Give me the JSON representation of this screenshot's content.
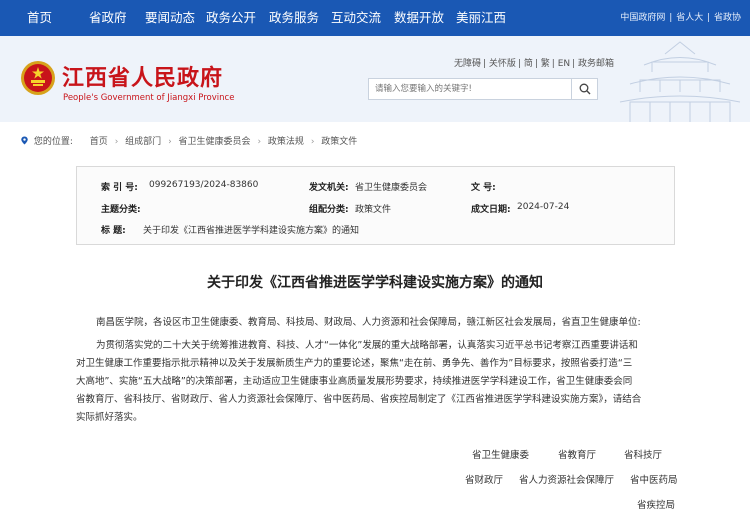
{
  "nav": {
    "items": [
      "首页",
      "省政府",
      "要闻动态",
      "政务公开",
      "政务服务",
      "互动交流",
      "数据开放",
      "美丽江西"
    ],
    "right": [
      "中国政府网",
      "省人大",
      "省政协"
    ]
  },
  "header": {
    "title": "江西省人民政府",
    "subtitle": "People's Government of Jiangxi Province",
    "util": [
      "无障碍",
      "关怀版",
      "简",
      "繁",
      "EN",
      "政务邮箱"
    ],
    "search_placeholder": "请输入您要输入的关键字!"
  },
  "breadcrumb": {
    "label": "您的位置:",
    "items": [
      "首页",
      "组成部门",
      "省卫生健康委员会",
      "政策法规",
      "政策文件"
    ]
  },
  "meta": {
    "index_label": "索  引 号:",
    "index_value": "099267193/2024-83860",
    "issuer_label": "发文机关:",
    "issuer_value": "省卫生健康委员会",
    "docno_label": "文    号:",
    "docno_value": "",
    "subject_label": "主题分类:",
    "subject_value": "",
    "org_label": "组配分类:",
    "org_value": "政策文件",
    "date_label": "成文日期:",
    "date_value": "2024-07-24",
    "heading_label": "标    题:",
    "heading_value": "关于印发《江西省推进医学学科建设实施方案》的通知"
  },
  "article": {
    "title": "关于印发《江西省推进医学学科建设实施方案》的通知",
    "addressee": "南昌医学院，各设区市卫生健康委、教育局、科技局、财政局、人力资源和社会保障局，赣江新区社会发展局，省直卫生健康单位:",
    "body_lines": [
      "为贯彻落实党的二十大关于统筹推进教育、科技、人才“一体化”发展的重大战略部署，认真落实习近平总书记考察江西重要讲话和",
      "对卫生健康工作重要指示批示精神以及关于发展新质生产力的重要论述，聚焦“走在前、勇争先、善作为”目标要求，按照省委打造“三",
      "大高地”、实施“五大战略”的决策部署，主动适应卫生健康事业高质量发展形势要求，持续推进医学学科建设工作，省卫生健康委会同",
      "省教育厅、省科技厅、省财政厅、省人力资源社会保障厅、省中医药局、省疾控局制定了《江西省推进医学学科建设实施方案》，请结合",
      "实际抓好落实。"
    ],
    "signatories": [
      "省卫生健康委",
      "省教育厅",
      "省科技厅",
      "省财政厅",
      "省人力资源社会保障厅",
      "省中医药局",
      "省疾控局"
    ]
  },
  "colors": {
    "nav": "#1a58b4",
    "brand_red": "#c8141a"
  }
}
